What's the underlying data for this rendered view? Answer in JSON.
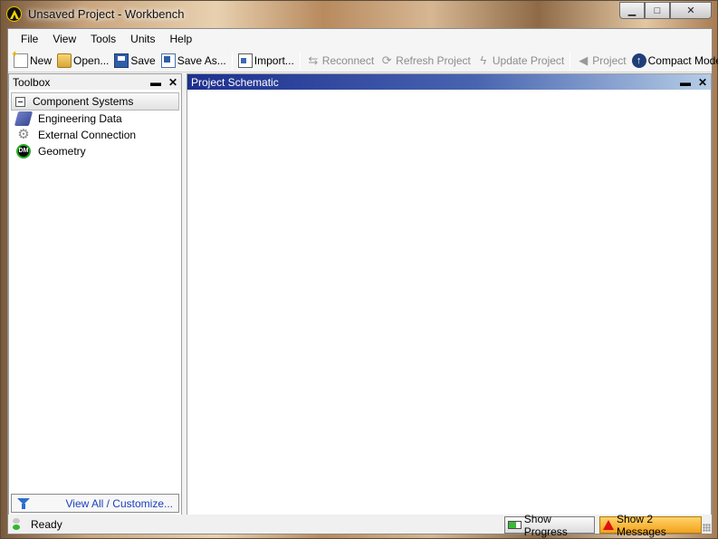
{
  "window": {
    "title": "Unsaved Project - Workbench",
    "minimize": "▁",
    "maximize": "□",
    "close": "✕"
  },
  "menu": [
    "File",
    "View",
    "Tools",
    "Units",
    "Help"
  ],
  "toolbar": {
    "new": "New",
    "open": "Open...",
    "save": "Save",
    "save_as": "Save As...",
    "import": "Import...",
    "reconnect": "Reconnect",
    "refresh": "Refresh Project",
    "update": "Update Project",
    "project": "Project",
    "compact": "Compact Mode"
  },
  "toolbox": {
    "title": "Toolbox",
    "pin": "▬",
    "close": "✕",
    "group": "Component Systems",
    "items": [
      {
        "label": "Engineering Data",
        "icon": "engineering-data-icon"
      },
      {
        "label": "External Connection",
        "icon": "gear-icon"
      },
      {
        "label": "Geometry",
        "icon": "design-modeler-icon"
      }
    ],
    "icon_text": {
      "geometry": "DM",
      "external": "⚙"
    },
    "footer_link": "View All / Customize..."
  },
  "schematic": {
    "title": "Project Schematic",
    "pin": "▬",
    "close": "✕"
  },
  "status": {
    "text": "Ready",
    "progress_button": "Show Progress",
    "messages_button": "Show 2 Messages"
  },
  "colors": {
    "schematic_header": "#1e2f8f",
    "messages_button": "#f3a21c",
    "link": "#1a3fc0"
  }
}
